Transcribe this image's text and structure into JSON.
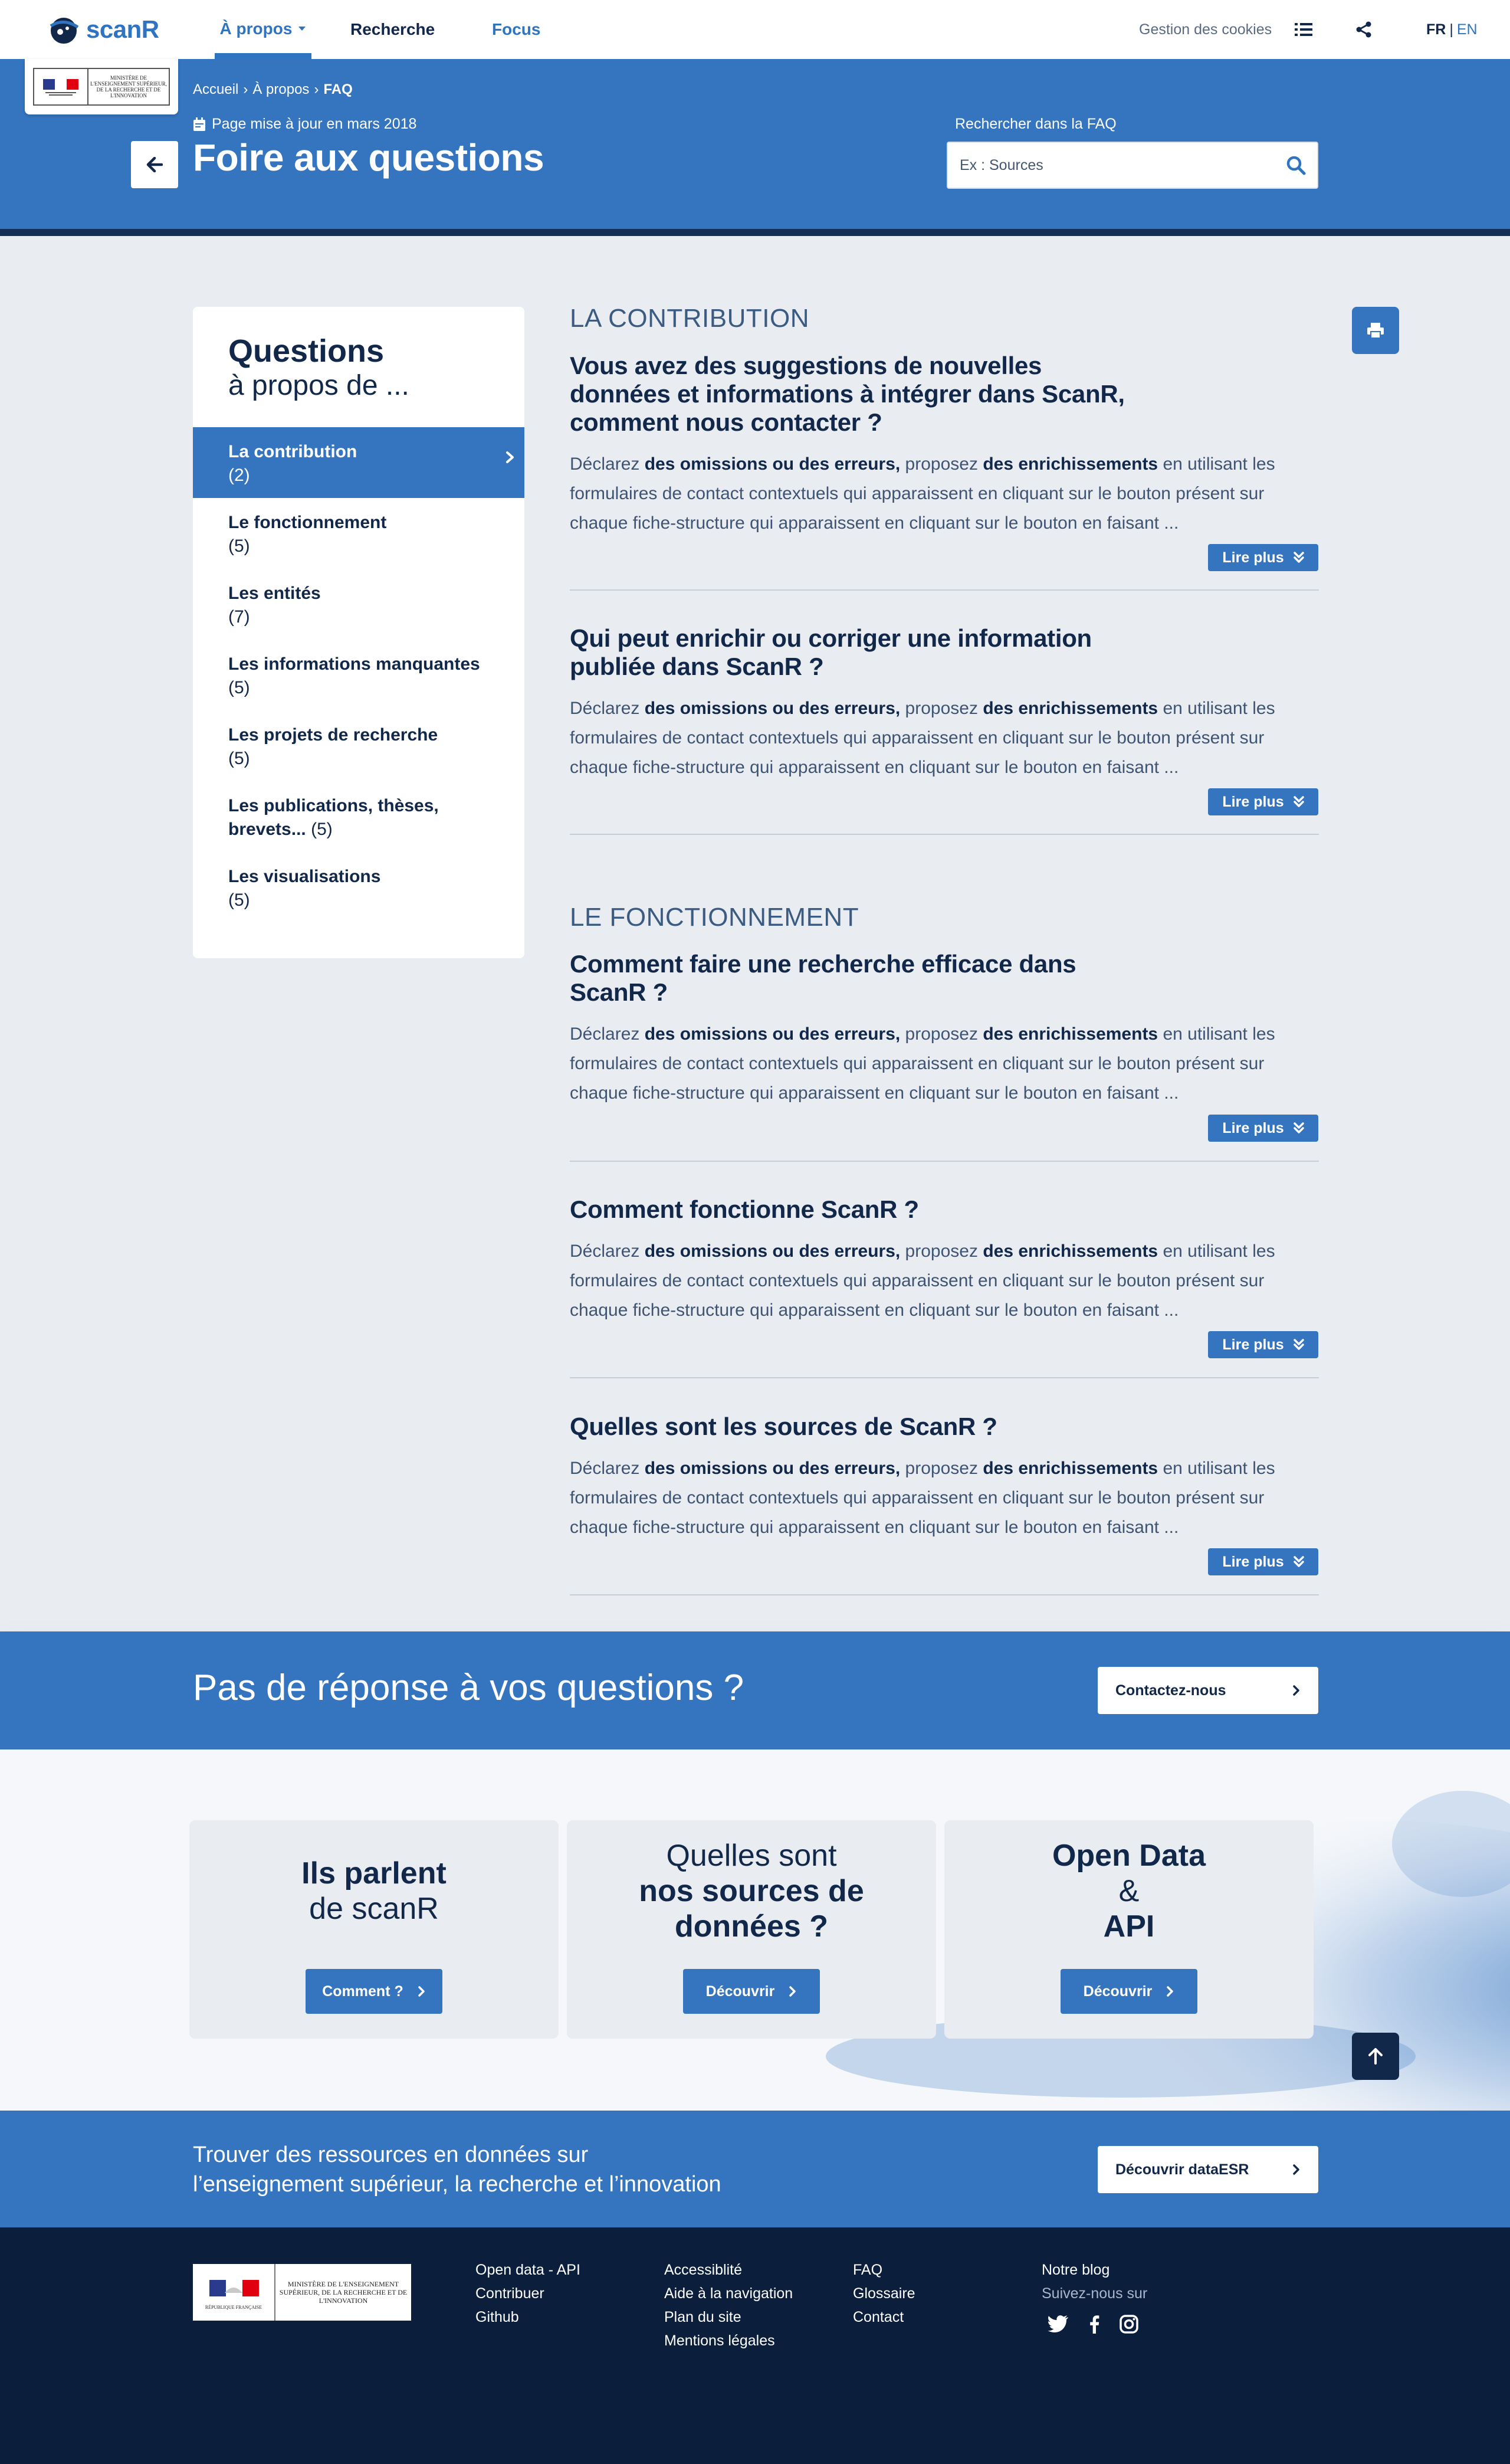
{
  "nav": {
    "logo_text": "scanR",
    "items": [
      "À propos",
      "Recherche",
      "Focus"
    ],
    "cookies": "Gestion des cookies",
    "lang_fr": "FR",
    "lang_sep": "|",
    "lang_en": "EN"
  },
  "hero": {
    "ministry_text": "MINISTÈRE DE L'ENSEIGNEMENT SUPÉRIEUR, DE LA RECHERCHE ET DE L'INNOVATION",
    "breadcrumb": [
      "Accueil",
      "À propos",
      "FAQ"
    ],
    "breadcrumb_sep": "›",
    "updated": "Page mise à jour en mars 2018",
    "title": "Foire aux questions",
    "search_label": "Rechercher dans la FAQ",
    "search_placeholder": "Ex : Sources"
  },
  "sidebar": {
    "title_bold": "Questions",
    "title_light": "à propos de ...",
    "items": [
      {
        "label": "La contribution",
        "count": "(2)"
      },
      {
        "label": "Le fonctionnement",
        "count": "(5)"
      },
      {
        "label": "Les entités",
        "count": "(7)"
      },
      {
        "label": "Les informations manquantes",
        "count": "(5)"
      },
      {
        "label": "Les projets de recherche",
        "count": "(5)"
      },
      {
        "label": "Les publications, thèses, brevets...",
        "count": "(5)"
      },
      {
        "label": "Les visualisations",
        "count": "(5)"
      }
    ]
  },
  "faq": {
    "more_label": "Lire plus",
    "answer": {
      "p1": "Déclarez ",
      "b1": "des omissions ou des erreurs,",
      "p2": " proposez ",
      "b2": "des enrichissements",
      "p3": " en utilisant les formulaires de contact contextuels qui apparaissent en cliquant sur le bouton présent sur chaque fiche-structure qui apparaissent en cliquant sur le bouton en faisant ..."
    },
    "sections": [
      {
        "title": "LA CONTRIBUTION",
        "questions": [
          "Vous avez des suggestions de nouvelles données et informations à intégrer dans ScanR, comment nous contacter ?",
          "Qui peut enrichir ou corriger une information publiée dans ScanR ?"
        ]
      },
      {
        "title": "LE FONCTIONNEMENT",
        "questions": [
          "Comment faire une recherche efficace dans ScanR ?",
          "Comment fonctionne ScanR ?",
          "Quelles sont les sources de ScanR ?"
        ]
      }
    ]
  },
  "contact": {
    "question": "Pas de réponse à vos questions ?",
    "button": "Contactez-nous"
  },
  "cards": [
    {
      "line1": "Ils parlent",
      "line2": "de scanR",
      "line3": "",
      "button": "Comment ?"
    },
    {
      "line1": "Quelles sont",
      "line2": "nos sources de",
      "line3": "données ?",
      "button": "Découvrir"
    },
    {
      "line1": "Open Data",
      "line2": "&",
      "line3": "API",
      "button": "Découvrir"
    }
  ],
  "dataesr": {
    "line1": "Trouver des ressources en données sur",
    "line2": "l’enseignement supérieur, la recherche et l’innovation",
    "button": "Découvrir dataESR"
  },
  "footer": {
    "ministry_text": "MINISTÈRE DE L'ENSEIGNEMENT SUPÉRIEUR, DE LA RECHERCHE ET DE L'INNOVATION",
    "republic": "RÉPUBLIQUE FRANÇAISE",
    "col1": [
      "Open data - API",
      "Contribuer",
      "Github"
    ],
    "col2": [
      "Accessiblité",
      "Aide à la navigation",
      "Plan du site",
      "Mentions légales"
    ],
    "col3": [
      "FAQ",
      "Glossaire",
      "Contact"
    ],
    "blog": "Notre blog",
    "follow": "Suivez-nous sur"
  },
  "colors": {
    "primary": "#3575c0",
    "navy": "#12284a",
    "footer_bg": "#0b1e3c",
    "page_bg": "#e9ecf0"
  },
  "icons": [
    "scanr-logo-icon",
    "caret-down-icon",
    "list-icon",
    "share-icon",
    "calendar-icon",
    "arrow-left-icon",
    "search-icon",
    "chevron-right-icon",
    "double-chevron-down-icon",
    "print-icon",
    "arrow-up-icon",
    "twitter-icon",
    "facebook-icon",
    "instagram-icon"
  ]
}
